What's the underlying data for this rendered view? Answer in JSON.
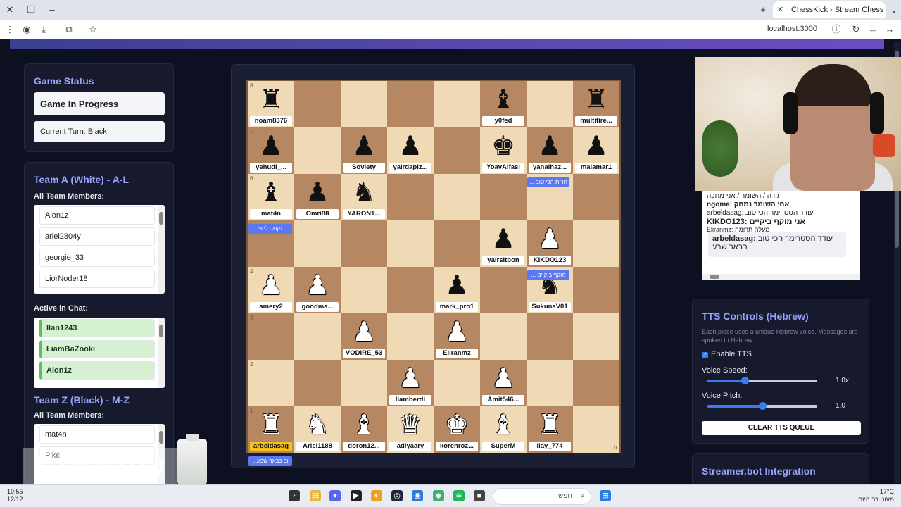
{
  "browser": {
    "tab_title": "ChessKick - Stream Chess G",
    "url": "localhost:3000"
  },
  "game_status": {
    "title": "Game Status",
    "state": "Game In Progress",
    "turn": "Current Turn: Black"
  },
  "team_a": {
    "title": "Team A (White) - A-L",
    "members_label": "All Team Members:",
    "members": [
      "Alon1z",
      "ariel2804y",
      "georgie_33",
      "LiorNoder18"
    ],
    "active_label": "Active in Chat:",
    "active": [
      "Ilan1243",
      "LiamBaZooki",
      "Alon1z"
    ]
  },
  "team_z": {
    "title": "Team Z (Black) - M-Z",
    "members_label": "All Team Members:",
    "members": [
      "mat4n",
      "Pike"
    ]
  },
  "board": {
    "squares": [
      [
        {
          "p": "♜",
          "c": "b",
          "n": "noam8376"
        },
        {},
        {},
        {},
        {},
        {
          "p": "♝",
          "c": "b",
          "n": "y0fed"
        },
        {},
        {
          "p": "♜",
          "c": "b",
          "n": "multifire..."
        }
      ],
      [
        {
          "p": "♟",
          "c": "b",
          "n": "yehudi_..."
        },
        {},
        {
          "p": "♟",
          "c": "b",
          "n": "Soviety"
        },
        {
          "p": "♟",
          "c": "b",
          "n": "yairdapiz..."
        },
        {},
        {
          "p": "♚",
          "c": "b",
          "n": "YoavAlfasi"
        },
        {
          "p": "♟",
          "c": "b",
          "n": "yanaihaz..."
        },
        {
          "p": "♟",
          "c": "b",
          "n": "malamar1"
        }
      ],
      [
        {
          "p": "♝",
          "c": "b",
          "n": "mat4n"
        },
        {
          "p": "♟",
          "c": "b",
          "n": "Omri88"
        },
        {
          "p": "♞",
          "c": "b",
          "n": "YARON1..."
        },
        {},
        {},
        {},
        {},
        {}
      ],
      [
        {},
        {},
        {},
        {},
        {},
        {
          "p": "♟",
          "c": "b",
          "n": "yairsitbon"
        },
        {
          "p": "♟",
          "c": "w",
          "n": "KIKDO123"
        },
        {}
      ],
      [
        {
          "p": "♟",
          "c": "w",
          "n": "amery2"
        },
        {
          "p": "♟",
          "c": "w",
          "n": "goodma..."
        },
        {},
        {},
        {
          "p": "♟",
          "c": "b",
          "n": "mark_pro1"
        },
        {},
        {
          "p": "♞",
          "c": "b",
          "n": "SukunaV01"
        },
        {}
      ],
      [
        {},
        {},
        {
          "p": "♟",
          "c": "w",
          "n": "VODIRE_53"
        },
        {},
        {
          "p": "♟",
          "c": "w",
          "n": "Eliranmz"
        },
        {},
        {},
        {}
      ],
      [
        {},
        {},
        {},
        {
          "p": "♟",
          "c": "w",
          "n": "liamberdi"
        },
        {},
        {
          "p": "♟",
          "c": "w",
          "n": "Amit546..."
        },
        {},
        {}
      ],
      [
        {
          "p": "♜",
          "c": "w",
          "n": "arbeldasag",
          "hl": true
        },
        {
          "p": "♞",
          "c": "w",
          "n": "Ariel1188"
        },
        {
          "p": "♝",
          "c": "w",
          "n": "doron12..."
        },
        {
          "p": "♛",
          "c": "w",
          "n": "adiyaary"
        },
        {
          "p": "♚",
          "c": "w",
          "n": "korenroz..."
        },
        {
          "p": "♝",
          "c": "w",
          "n": "SuperM"
        },
        {
          "p": "♜",
          "c": "w",
          "n": "Ilay_774"
        },
        {}
      ]
    ],
    "ranks": [
      "8",
      "7",
      "6",
      "5",
      "4",
      "3",
      "2",
      "1"
    ],
    "file_h": "h",
    "bubbles": {
      "b1": "... חרית הכי טוב",
      "b2": "נקמה ליוני",
      "b3": "... מוקף ביקיים",
      "b4": "...וב כבאר שבע"
    }
  },
  "chat": {
    "lines": [
      {
        "text": "תודה / השומר / אני מחכה",
        "bold": false
      },
      {
        "text": "ngoma: אחי השומר נמחק",
        "bold": true
      },
      {
        "text": "arbeldasag: עודד הסטרימר הכי טוב",
        "bold": false
      },
      {
        "text": "KIKDO123: אני מוקף ביקיים",
        "bold": true
      },
      {
        "text": "Eliranmz: מעלה תרומה",
        "bold": false
      }
    ],
    "main_user": "arbeldasag:",
    "main_text": "עודד הסטרימר הכי טוב בבאר שבע"
  },
  "tts": {
    "title": "TTS Controls (Hebrew)",
    "description": "Each piece uses a unique Hebrew voice. Messages are spoken in Hebrew.",
    "enable_label": "Enable TTS",
    "enabled": true,
    "speed_label": "Voice Speed:",
    "speed_value": "1.0x",
    "speed_fraction": 0.34,
    "pitch_label": "Voice Pitch:",
    "pitch_value": "1.0",
    "pitch_fraction": 0.5,
    "clear_label": "CLEAR TTS QUEUE"
  },
  "streamerbot": {
    "title": "Streamer.bot Integration"
  },
  "overlay": {
    "logo": "LIBERO"
  },
  "taskbar": {
    "time": "19:55",
    "date": "12/12",
    "search_placeholder": "חפש",
    "weather_temp": "17°C",
    "weather_text": "מעונן רב היום"
  },
  "colors": {
    "accent": "#9aa3ff",
    "light_square": "#f0d9b5",
    "dark_square": "#b58863",
    "highlight": "#f6c21a"
  }
}
